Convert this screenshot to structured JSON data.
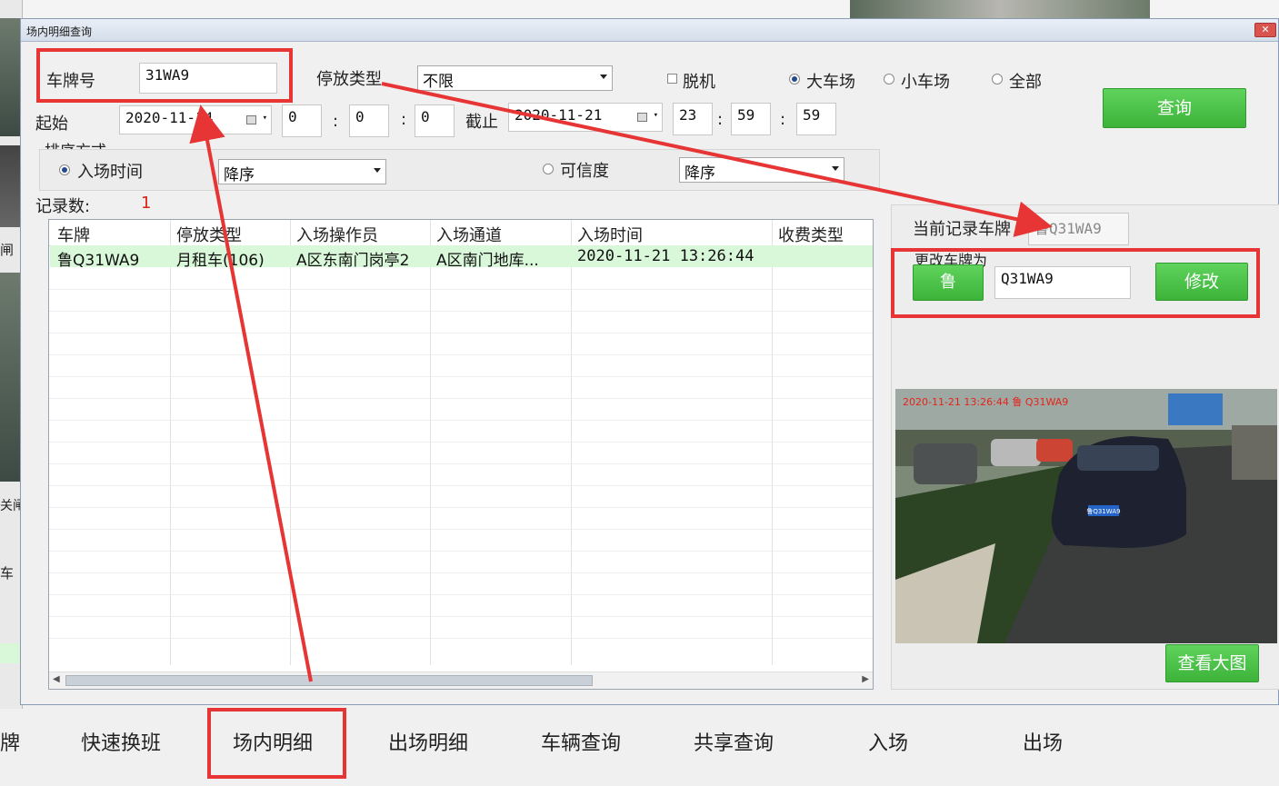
{
  "dialog": {
    "title": "场内明细查询",
    "close": "✕"
  },
  "filters": {
    "plate_label": "车牌号",
    "plate_value": "31WA9",
    "park_type_label": "停放类型",
    "park_type_value": "不限",
    "offline_label": "脱机",
    "big_lot_label": "大车场",
    "small_lot_label": "小车场",
    "all_label": "全部",
    "query_button": "查询",
    "start_label": "起始",
    "start_date": "2020-11-14",
    "start_h": "0",
    "start_m": "0",
    "start_s": "0",
    "end_label": "截止",
    "end_date": "2020-11-21",
    "end_h": "23",
    "end_m": "59",
    "end_s": "59",
    "colon": ":",
    "sort_group_label": "排序方式",
    "sort_entry_time_label": "入场时间",
    "sort_entry_time_order": "降序",
    "sort_confidence_label": "可信度",
    "sort_confidence_order": "降序"
  },
  "records": {
    "count_label": "记录数:",
    "count_value": "1",
    "columns": [
      "车牌",
      "停放类型",
      "入场操作员",
      "入场通道",
      "入场时间",
      "收费类型"
    ],
    "rows": [
      [
        "鲁Q31WA9",
        "月租车(106)",
        "A区东南门岗亭2",
        "A区南门地库...",
        "2020-11-21 13:26:44",
        ""
      ]
    ]
  },
  "side": {
    "current_plate_label": "当前记录车牌",
    "current_plate_value": "鲁Q31WA9",
    "change_label": "更改车牌为",
    "province_button": "鲁",
    "new_plate_value": "Q31WA9",
    "modify_button": "修改",
    "photo_overlay": "2020-11-21 13:26:44 鲁 Q31WA9",
    "car_plate_text": "鲁Q31WA9",
    "view_large_button": "查看大图"
  },
  "bottom_tabs": [
    "牌",
    "快速换班",
    "场内明细",
    "出场明细",
    "车辆查询",
    "共享查询",
    "入场",
    "出场"
  ],
  "background_labels": [
    "闸",
    "关闸",
    "车"
  ],
  "colors": {
    "accent_green": "#4cc449",
    "annotation_red": "#e73535",
    "row_highlight": "#d9f7d9"
  }
}
